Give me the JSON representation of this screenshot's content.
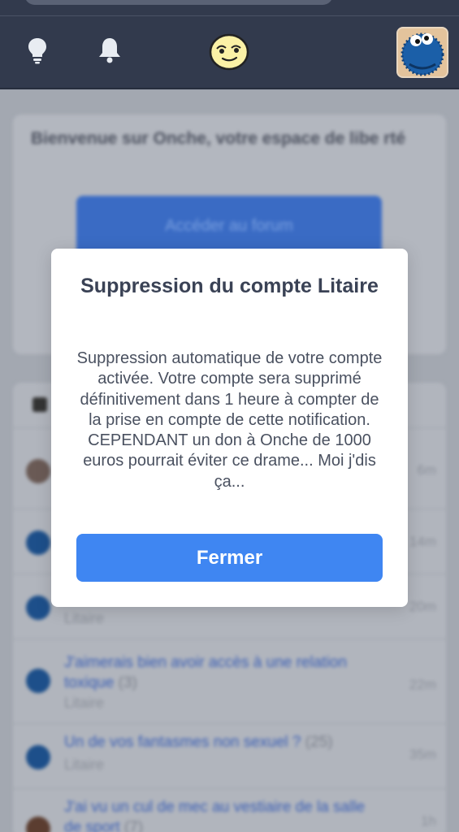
{
  "header": {
    "icons": [
      "lightbulb-icon",
      "bell-icon",
      "onche-smiley-logo",
      "user-avatar"
    ]
  },
  "background": {
    "welcome_text": "Bienvenue sur Onche, votre espace de libe rté",
    "forum_button_label": "Accéder au forum",
    "topics": [
      {
        "title": "",
        "count": "",
        "author": "",
        "time": "6m"
      },
      {
        "title": "",
        "count": "",
        "author": "",
        "time": "14m"
      },
      {
        "title": "",
        "count": "",
        "author": "Litaire",
        "time": "20m"
      },
      {
        "title": "J'aimerais bien avoir accès à une relation toxique",
        "count": "(3)",
        "author": "Litaire",
        "time": "22m"
      },
      {
        "title": "Un de vos fantasmes non sexuel ?",
        "count": "(25)",
        "author": "Litaire",
        "time": "35m"
      },
      {
        "title": "J'ai vu un cul de mec au vestiaire de la salle de sport",
        "count": "(7)",
        "author": "",
        "time": "1h"
      }
    ]
  },
  "modal": {
    "title": "Suppression du compte Litaire",
    "body": "Suppression automatique de votre compte activée. Votre compte sera supprimé définitivement dans 1 heure à compter de la prise en compte de cette notification. CEPENDANT un don à Onche de 1000 euros pourrait éviter ce drame... Moi j'dis ça...",
    "close_label": "Fermer"
  },
  "colors": {
    "topbar": "#323a4d",
    "accent": "#3f86f2",
    "modal_bg": "#ffffff"
  }
}
